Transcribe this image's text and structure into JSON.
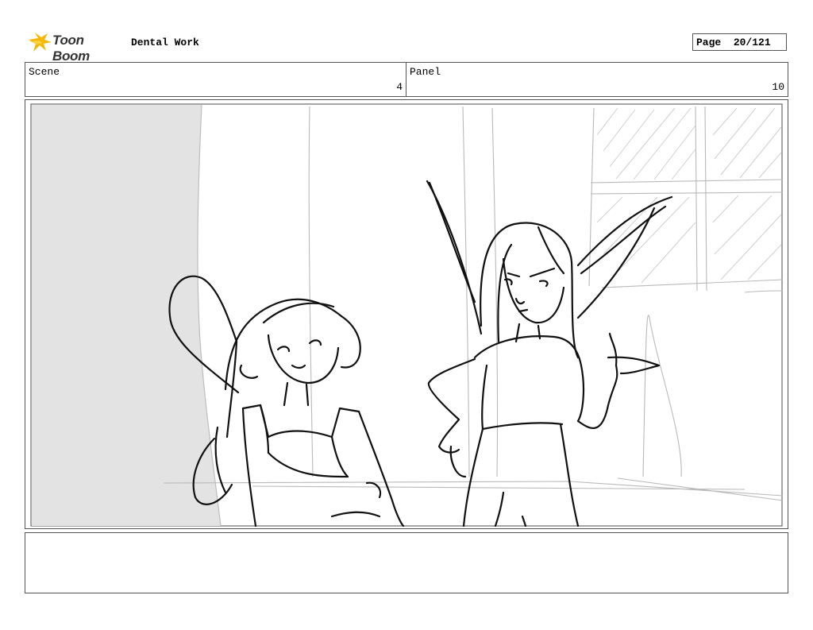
{
  "header": {
    "logo_text": "Toon Boom",
    "project_title": "Dental Work",
    "page_label": "Page",
    "page_number": "20/121"
  },
  "scene": {
    "label": "Scene",
    "value": "4"
  },
  "panel": {
    "label": "Panel",
    "value": "10"
  },
  "notes": {
    "text": ""
  },
  "colors": {
    "border": "#555555",
    "logo_accent": "#F5B800",
    "shadow_fill": "#E3E3E3"
  }
}
